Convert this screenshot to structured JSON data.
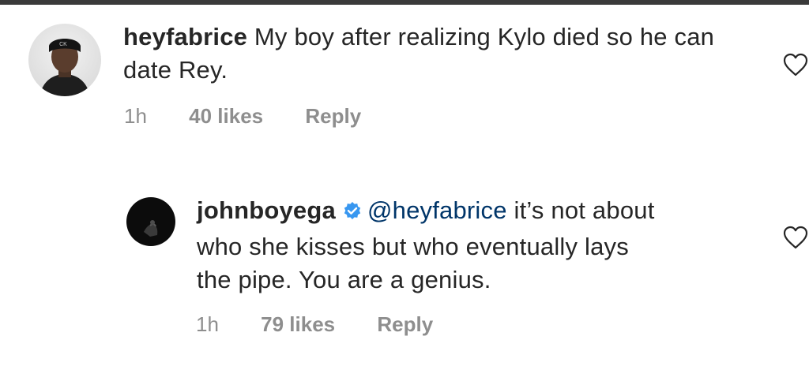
{
  "comments": [
    {
      "username": "heyfabrice",
      "verified": false,
      "mention": "",
      "text": "My boy after realizing Kylo died so he can date Rey.",
      "time": "1h",
      "likes": "40 likes",
      "reply": "Reply",
      "avatar_icon": "person-photo"
    },
    {
      "username": "johnboyega",
      "verified": true,
      "mention": "@heyfabrice",
      "text_line1": "it’s not about",
      "text_line2": "who she kisses but who eventually lays",
      "text_line3": "the pipe. You are a genius.",
      "time": "1h",
      "likes": "79 likes",
      "reply": "Reply",
      "avatar_icon": "dark-photo"
    }
  ],
  "colors": {
    "text": "#262626",
    "meta": "#8e8e8e",
    "verified": "#3897f0",
    "mention": "#003569"
  },
  "icons": [
    "heart-icon",
    "verified-badge-icon"
  ]
}
